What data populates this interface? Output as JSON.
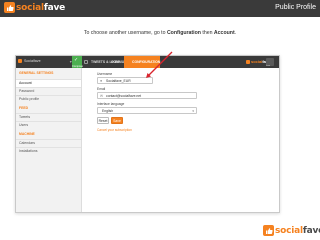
{
  "slide": {
    "title": "Public Profile",
    "brand": {
      "word_1": "social",
      "word_2": "fave"
    },
    "instruction": {
      "prefix": "To choose another username, go to ",
      "link_1": "Configuration",
      "middle": " then ",
      "link_2": "Account",
      "suffix": "."
    }
  },
  "app": {
    "account_name": "Socialfave",
    "compose_label": "Compose",
    "tabs": {
      "feeds": "TWEETS & LIKES",
      "community": "COMMUNITY",
      "configuration": "CONFIGURATION"
    },
    "mini_logo": {
      "word_1": "social",
      "word_2": "fave"
    },
    "mini_label": "fave",
    "sidebar": {
      "section_1": "GENERAL SETTINGS",
      "items_1": [
        "Account",
        "Password",
        "Public profile"
      ],
      "section_2": "FEED",
      "items_2": [
        "Tweets",
        "Users"
      ],
      "section_3": "MACHINE",
      "items_3": [
        "Calendars",
        "Installations"
      ]
    },
    "form": {
      "username_label": "Username",
      "username_value": "Socialfave_EUR",
      "email_label": "Email",
      "email_value": "contact@socialfave.net",
      "language_label": "Interface language",
      "language_value": "English",
      "reset_label": "Reset",
      "save_label": "Save",
      "cancel_label": "Cancel your subscription"
    }
  },
  "colors": {
    "accent": "#f58220",
    "dark_bar": "#3a3a3a",
    "compose_green": "#4caf50",
    "annotation_red": "#d9232d"
  }
}
